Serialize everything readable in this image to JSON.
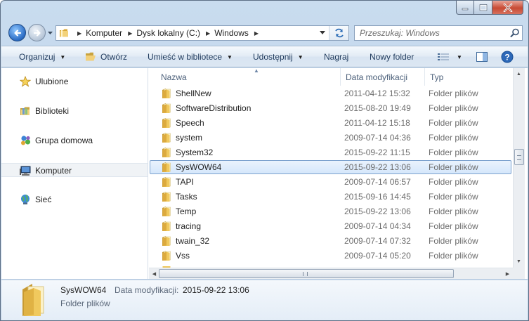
{
  "window": {
    "caption_buttons": [
      "minimize",
      "maximize",
      "close"
    ]
  },
  "address": {
    "crumbs": [
      "Komputer",
      "Dysk lokalny (C:)",
      "Windows"
    ]
  },
  "search": {
    "placeholder": "Przeszukaj: Windows"
  },
  "toolbar": {
    "organize": "Organizuj",
    "open": "Otwórz",
    "library": "Umieść w bibliotece",
    "share": "Udostępnij",
    "burn": "Nagraj",
    "new_folder": "Nowy folder"
  },
  "sidebar": {
    "items": [
      {
        "label": "Ulubione",
        "icon": "star-icon"
      },
      {
        "label": "Biblioteki",
        "icon": "libraries-icon"
      },
      {
        "label": "Grupa domowa",
        "icon": "homegroup-icon"
      },
      {
        "label": "Komputer",
        "icon": "computer-icon",
        "selected": true
      },
      {
        "label": "Sieć",
        "icon": "network-icon"
      }
    ]
  },
  "columns": {
    "name": "Nazwa",
    "date": "Data modyfikacji",
    "type": "Typ"
  },
  "files": [
    {
      "name": "ShellNew",
      "date": "2011-04-12 15:32",
      "type": "Folder plików"
    },
    {
      "name": "SoftwareDistribution",
      "date": "2015-08-20 19:49",
      "type": "Folder plików"
    },
    {
      "name": "Speech",
      "date": "2011-04-12 15:18",
      "type": "Folder plików"
    },
    {
      "name": "system",
      "date": "2009-07-14 04:36",
      "type": "Folder plików"
    },
    {
      "name": "System32",
      "date": "2015-09-22 11:15",
      "type": "Folder plików"
    },
    {
      "name": "SysWOW64",
      "date": "2015-09-22 13:06",
      "type": "Folder plików",
      "selected": true
    },
    {
      "name": "TAPI",
      "date": "2009-07-14 06:57",
      "type": "Folder plików"
    },
    {
      "name": "Tasks",
      "date": "2015-09-16 14:45",
      "type": "Folder plików"
    },
    {
      "name": "Temp",
      "date": "2015-09-22 13:06",
      "type": "Folder plików"
    },
    {
      "name": "tracing",
      "date": "2009-07-14 04:34",
      "type": "Folder plików"
    },
    {
      "name": "twain_32",
      "date": "2009-07-14 07:32",
      "type": "Folder plików"
    },
    {
      "name": "Vss",
      "date": "2009-07-14 05:20",
      "type": "Folder plików"
    }
  ],
  "details": {
    "name": "SysWOW64",
    "date_label": "Data modyfikacji:",
    "date_value": "2015-09-22 13:06",
    "type": "Folder plików"
  },
  "colors": {
    "accent": "#1e395b",
    "selection": "#d5e7fb",
    "folder": "#e8c25c"
  }
}
